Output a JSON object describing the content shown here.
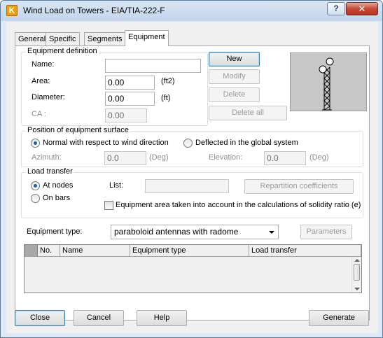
{
  "window": {
    "title": "Wind Load on Towers - EIA/TIA-222-F",
    "help_button": "?",
    "close_button": "✕"
  },
  "tabs": [
    {
      "label": "General",
      "active": false
    },
    {
      "label": "Specific",
      "active": false
    },
    {
      "label": "Segments",
      "active": false
    },
    {
      "label": "Equipment",
      "active": true
    }
  ],
  "equipment_definition": {
    "title": "Equipment definition",
    "name_label": "Name:",
    "name_value": "",
    "area_label": "Area:",
    "area_value": "0.00",
    "area_unit": "(ft2)",
    "diameter_label": "Diameter:",
    "diameter_value": "0.00",
    "diameter_unit": "(ft)",
    "ca_label": "CA :",
    "ca_value": "0.00"
  },
  "actions": {
    "new": "New",
    "modify": "Modify",
    "delete": "Delete",
    "delete_all": "Delete all"
  },
  "position": {
    "title": "Position of equipment surface",
    "option_normal": "Normal with respect to wind direction",
    "option_deflected": "Deflected in the global system",
    "selected": "normal",
    "azimuth_label": "Azimuth:",
    "azimuth_value": "0.0",
    "azimuth_unit": "(Deg)",
    "elevation_label": "Elevation:",
    "elevation_value": "0.0",
    "elevation_unit": "(Deg)"
  },
  "load_transfer": {
    "title": "Load transfer",
    "option_nodes": "At nodes",
    "option_bars": "On bars",
    "selected": "nodes",
    "list_label": "List:",
    "list_value": "",
    "repartition_button": "Repartition coefficients",
    "solidity_checkbox": "Equipment area taken into account in the calculations of solidity ratio (e)",
    "solidity_checked": false
  },
  "equipment_type": {
    "label": "Equipment type:",
    "value": "paraboloid antennas with radome",
    "parameters_button": "Parameters"
  },
  "table": {
    "columns": [
      "No.",
      "Name",
      "Equipment type",
      "Load transfer"
    ],
    "rows": []
  },
  "footer": {
    "close": "Close",
    "cancel": "Cancel",
    "help": "Help",
    "generate": "Generate"
  },
  "colors": {
    "title_bar": "#c8d8ee",
    "close_red": "#c54a36",
    "preview_bg": "#c8c8c8",
    "radio_dot": "#1d5fa8"
  }
}
